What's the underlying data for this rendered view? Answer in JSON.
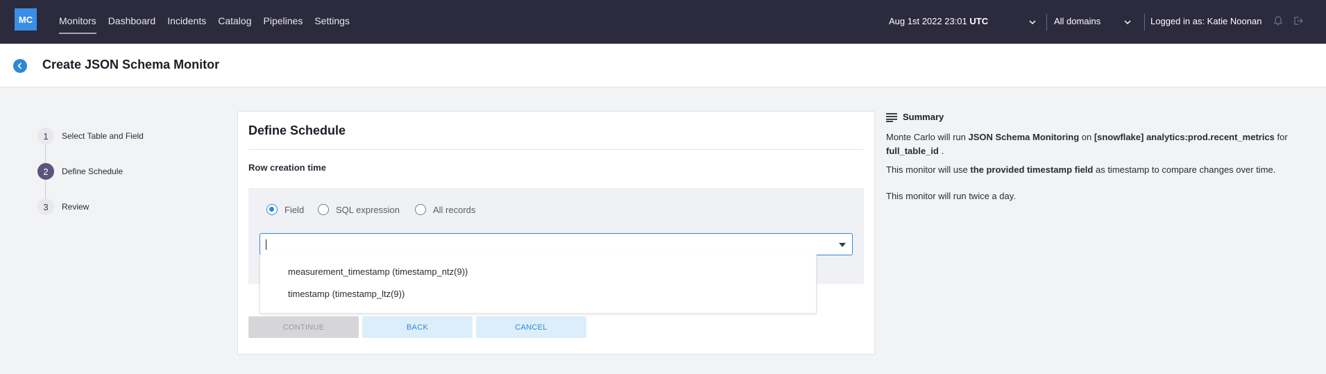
{
  "app": {
    "logo": "MC",
    "nav": [
      "Monitors",
      "Dashboard",
      "Incidents",
      "Catalog",
      "Pipelines",
      "Settings"
    ],
    "date": "Aug 1st 2022 23:01",
    "timezone": "UTC",
    "domains": "All domains",
    "user": "Logged in as: Katie Noonan"
  },
  "header": {
    "title": "Create JSON Schema Monitor"
  },
  "steps": [
    {
      "num": "1",
      "label": "Select Table and Field"
    },
    {
      "num": "2",
      "label": "Define Schedule"
    },
    {
      "num": "3",
      "label": "Review"
    }
  ],
  "card": {
    "title": "Define Schedule",
    "row_label": "Row creation time",
    "radios": [
      "Field",
      "SQL expression",
      "All records"
    ],
    "selected_radio": "Field",
    "select_value": "",
    "options": [
      "measurement_timestamp (timestamp_ntz(9))",
      "timestamp (timestamp_ltz(9))"
    ],
    "buttons": {
      "continue": "CONTINUE",
      "back": "BACK",
      "cancel": "CANCEL"
    }
  },
  "summary": {
    "title": "Summary",
    "p1_a": "Monte Carlo will run ",
    "p1_b": "JSON Schema Monitoring",
    "p1_c": " on ",
    "p1_d": "[snowflake] analytics:prod.recent_metrics",
    "p1_e": " for ",
    "p1_f": "full_table_id",
    "p1_g": " .",
    "p2_a": "This monitor will use ",
    "p2_b": "the provided timestamp field",
    "p2_c": " as timestamp to compare changes over time.",
    "p3": "This monitor will run twice a day."
  },
  "colors": {
    "nav_bg": "#2c2a3d",
    "accent": "#2f88d3",
    "step_active": "#5d547e"
  }
}
